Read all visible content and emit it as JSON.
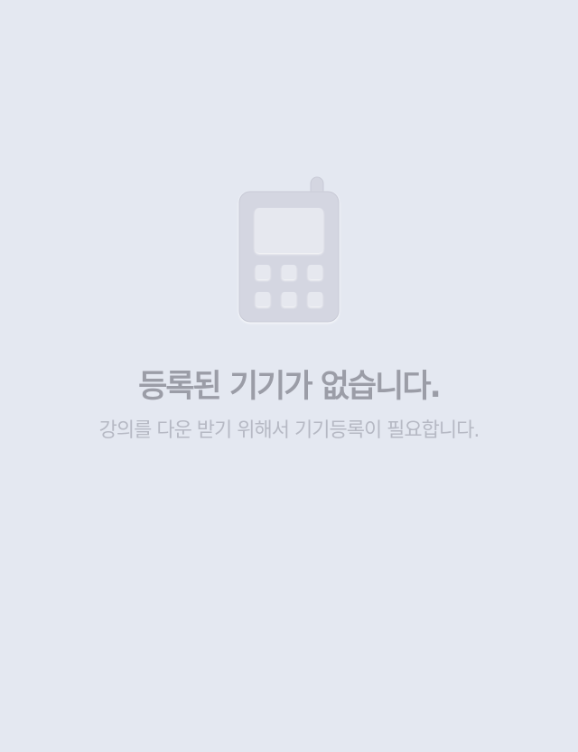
{
  "empty_state": {
    "icon": "mobile-phone-icon",
    "title": "등록된 기기가 없습니다.",
    "subtitle": "강의를 다운 받기 위해서 기기등록이 필요합니다."
  },
  "colors": {
    "background": "#e4e8f1",
    "icon_fill": "#d4d6e1",
    "icon_screen": "#e6e8ef",
    "title": "#9b9da7",
    "subtitle": "#b6b9c4"
  }
}
